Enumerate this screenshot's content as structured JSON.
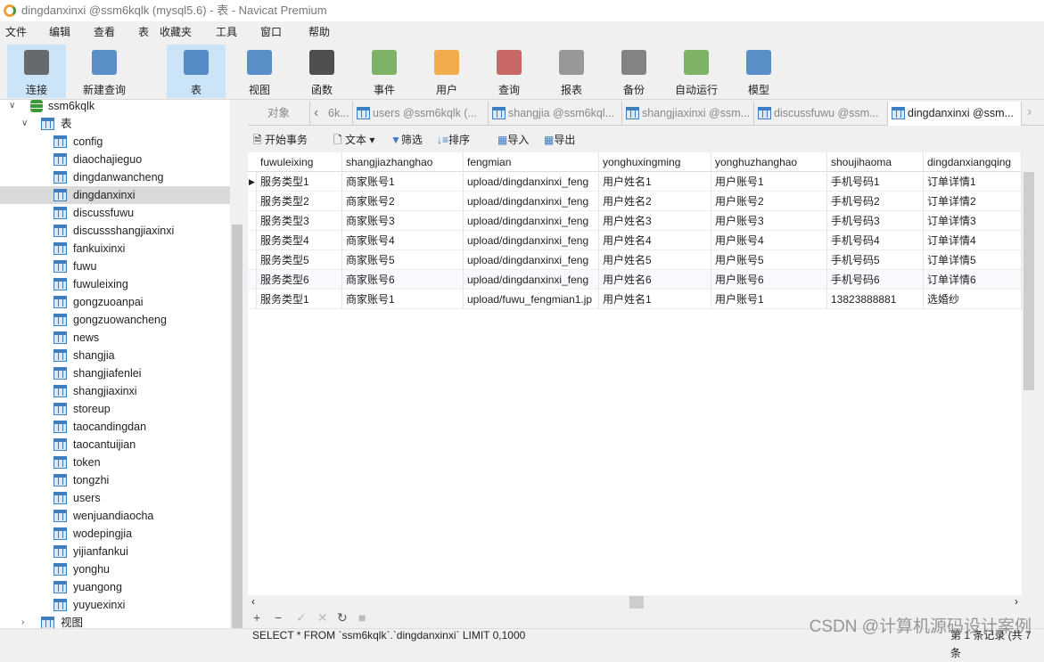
{
  "window": {
    "title": "dingdanxinxi @ssm6kqlk (mysql5.6) - 表 - Navicat Premium"
  },
  "menu": [
    "文件",
    "编辑",
    "查看",
    "表",
    "收藏夹",
    "工具",
    "窗口",
    "帮助"
  ],
  "toolbar": [
    {
      "label": "连接",
      "icon": "connect-plug-icon",
      "color": "#555555"
    },
    {
      "label": "新建查询",
      "icon": "new-query-icon",
      "color": "#3f7dbf"
    },
    {
      "label": "表",
      "icon": "table-icon",
      "color": "#3f7dbf",
      "active": true
    },
    {
      "label": "视图",
      "icon": "view-icon",
      "color": "#3f7dbf"
    },
    {
      "label": "函数",
      "icon": "function-icon",
      "color": "#333333"
    },
    {
      "label": "事件",
      "icon": "clock-icon",
      "color": "#6aa84f"
    },
    {
      "label": "用户",
      "icon": "user-icon",
      "color": "#f0a030"
    },
    {
      "label": "查询",
      "icon": "query-icon",
      "color": "#c0504d"
    },
    {
      "label": "报表",
      "icon": "report-icon",
      "color": "#888888"
    },
    {
      "label": "备份",
      "icon": "backup-icon",
      "color": "#707070"
    },
    {
      "label": "自动运行",
      "icon": "schedule-icon",
      "color": "#6aa84f"
    },
    {
      "label": "模型",
      "icon": "model-icon",
      "color": "#3f7dbf"
    }
  ],
  "sidebar": {
    "database": "ssm6kqlk",
    "tables_label": "表",
    "views_label": "视图",
    "selected": "dingdanxinxi",
    "tables": [
      "config",
      "diaochajieguo",
      "dingdanwancheng",
      "dingdanxinxi",
      "discussfuwu",
      "discussshangjiaxinxi",
      "fankuixinxi",
      "fuwu",
      "fuwuleixing",
      "gongzuoanpai",
      "gongzuowancheng",
      "news",
      "shangjia",
      "shangjiafenlei",
      "shangjiaxinxi",
      "storeup",
      "taocandingdan",
      "taocantuijian",
      "token",
      "tongzhi",
      "users",
      "wenjuandiaocha",
      "wodepingjia",
      "yijianfankui",
      "yonghu",
      "yuangong",
      "yuyuexinxi"
    ]
  },
  "tabs": {
    "objects": "对象",
    "items": [
      "6k...",
      "users @ssm6kqlk (...",
      "shangjia @ssm6kql...",
      "shangjiaxinxi @ssm...",
      "discussfuwu @ssm...",
      "dingdanxinxi @ssm..."
    ],
    "active": 5
  },
  "grid_toolbar": {
    "begin_transaction": "开始事务",
    "text": "文本",
    "filter": "筛选",
    "sort": "排序",
    "import": "导入",
    "export": "导出"
  },
  "grid": {
    "columns": [
      "fuwuleixing",
      "shangjiazhanghao",
      "fengmian",
      "yonghuxingming",
      "yonghuzhanghao",
      "shoujihaoma",
      "dingdanxiangqing"
    ],
    "rows": [
      [
        "服务类型1",
        "商家账号1",
        "upload/dingdanxinxi_feng",
        "用户姓名1",
        "用户账号1",
        "手机号码1",
        "订单详情1"
      ],
      [
        "服务类型2",
        "商家账号2",
        "upload/dingdanxinxi_feng",
        "用户姓名2",
        "用户账号2",
        "手机号码2",
        "订单详情2"
      ],
      [
        "服务类型3",
        "商家账号3",
        "upload/dingdanxinxi_feng",
        "用户姓名3",
        "用户账号3",
        "手机号码3",
        "订单详情3"
      ],
      [
        "服务类型4",
        "商家账号4",
        "upload/dingdanxinxi_feng",
        "用户姓名4",
        "用户账号4",
        "手机号码4",
        "订单详情4"
      ],
      [
        "服务类型5",
        "商家账号5",
        "upload/dingdanxinxi_feng",
        "用户姓名5",
        "用户账号5",
        "手机号码5",
        "订单详情5"
      ],
      [
        "服务类型6",
        "商家账号6",
        "upload/dingdanxinxi_feng",
        "用户姓名6",
        "用户账号6",
        "手机号码6",
        "订单详情6"
      ],
      [
        "服务类型1",
        "商家账号1",
        "upload/fuwu_fengmian1.jp",
        "用户姓名1",
        "用户账号1",
        "13823888881",
        "选婚纱"
      ]
    ]
  },
  "status": {
    "sql": "SELECT * FROM `ssm6kqlk`.`dingdanxinxi` LIMIT 0,1000",
    "records": "第 1 条记录 (共 7 条"
  },
  "watermark": "CSDN @计算机源码设计案例"
}
